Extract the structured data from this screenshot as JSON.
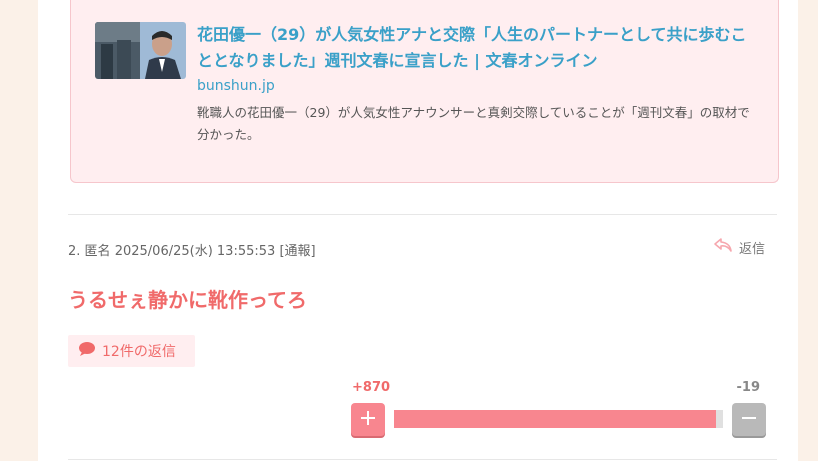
{
  "link_card": {
    "title": "花田優一（29）が人気女性アナと交際「人生のパートナーとして共に歩むこととなりました」週刊文春に宣言した | 文春オンライン",
    "domain": "bunshun.jp",
    "description": "靴職人の花田優一（29）が人気女性アナウンサーと真剣交際していることが「週刊文春」の取材で分かった。"
  },
  "comment": {
    "number": "2.",
    "author": "匿名",
    "datetime": "2025/06/25(水) 13:55:53",
    "report_label": "[通報]",
    "reply_label": "返信",
    "body": "うるせぇ静かに靴作ってろ",
    "replies_label": "12件の返信",
    "votes": {
      "plus_label": "+870",
      "minus_label": "-19",
      "plus_ratio": 0.979
    }
  },
  "colors": {
    "accent_pink": "#f06a6a",
    "link_blue": "#3aa0c8",
    "vote_plus": "#f8868f",
    "vote_minus": "#b9b9b9"
  },
  "icons": {
    "reply": "reply-arrow-icon",
    "speech": "speech-bubble-icon",
    "plus": "plus-icon",
    "minus": "minus-icon"
  }
}
